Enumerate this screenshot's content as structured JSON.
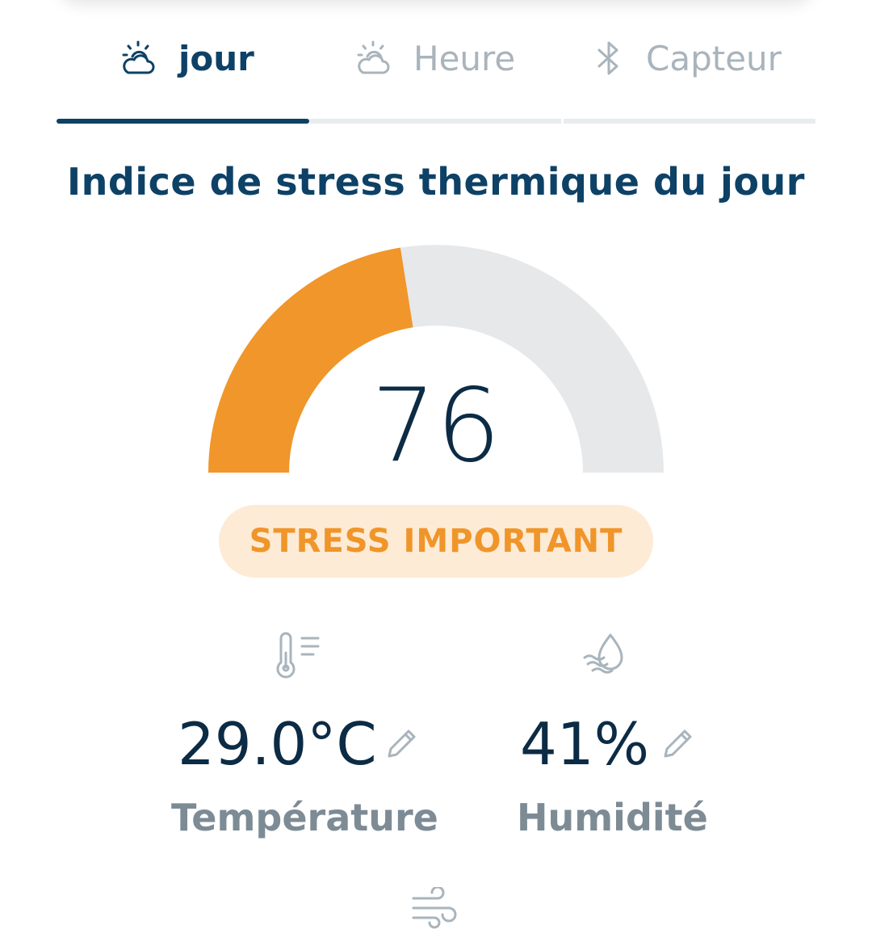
{
  "tabs": [
    {
      "label": "jour",
      "icon": "sun-cloud-icon",
      "active": true
    },
    {
      "label": "Heure",
      "icon": "sun-cloud-icon",
      "active": false
    },
    {
      "label": "Capteur",
      "icon": "bluetooth-icon",
      "active": false
    }
  ],
  "title": "Indice de stress thermique du jour",
  "gauge": {
    "value": "76",
    "fill_fraction": 0.45,
    "fill_color": "#f0962b",
    "track_color": "#e6e8ea"
  },
  "status_badge": {
    "label": "STRESS IMPORTANT",
    "text_color": "#f0952a",
    "bg_color": "#fdebd5"
  },
  "metrics": {
    "temperature": {
      "value": "29.0°C",
      "label": "Température",
      "icon": "thermometer-icon"
    },
    "humidity": {
      "value": "41%",
      "label": "Humidité",
      "icon": "humidity-drop-icon"
    }
  },
  "wind": {
    "icon": "wind-icon"
  },
  "colors": {
    "primary": "#0e4166",
    "inactive": "#a9b4bc"
  }
}
